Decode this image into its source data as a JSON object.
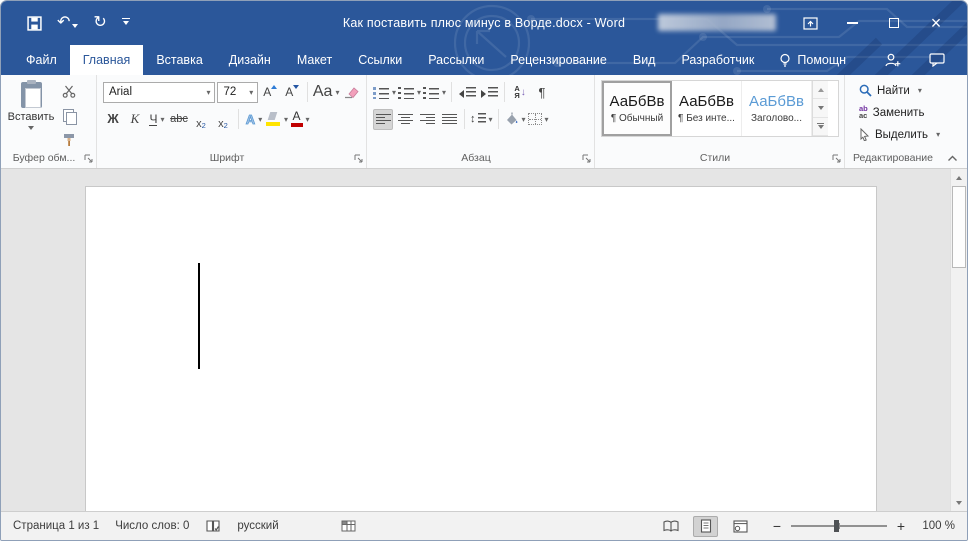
{
  "titlebar": {
    "title": "Как поставить плюс минус в Ворде.docx - Word"
  },
  "tabs": {
    "file": "Файл",
    "active": "Главная",
    "items": [
      "Главная",
      "Вставка",
      "Дизайн",
      "Макет",
      "Ссылки",
      "Рассылки",
      "Рецензирование",
      "Вид",
      "Разработчик"
    ],
    "assistant_label": "Помощн"
  },
  "ribbon": {
    "clipboard": {
      "paste_label": "Вставить",
      "group_label": "Буфер обм..."
    },
    "font": {
      "family_value": "Arial",
      "size_value": "72",
      "grow_letter": "А",
      "shrink_letter": "А",
      "case_label": "Aa",
      "bold": "Ж",
      "italic": "К",
      "underline": "Ч",
      "strikethrough": "abc",
      "subscript": {
        "base": "x",
        "script": "2"
      },
      "superscript": {
        "base": "x",
        "script": "2"
      },
      "effects_letter": "А",
      "fontcolor_letter": "А",
      "group_label": "Шрифт"
    },
    "paragraph": {
      "sort_top": "А",
      "sort_bottom": "Я",
      "pilcrow": "¶",
      "group_label": "Абзац"
    },
    "styles": {
      "group_label": "Стили",
      "items": [
        {
          "preview": "АаБбВв",
          "name": "¶ Обычный"
        },
        {
          "preview": "АаБбВв",
          "name": "¶ Без инте..."
        },
        {
          "preview": "АаБбВв",
          "name": "Заголово..."
        }
      ]
    },
    "editing": {
      "find_label": "Найти",
      "replace_label": "Заменить",
      "select_label": "Выделить",
      "replace_icon_top": "ab",
      "replace_icon_bottom": "ac",
      "group_label": "Редактирование"
    }
  },
  "statusbar": {
    "page_info": "Страница 1 из 1",
    "word_count": "Число слов: 0",
    "language": "русский",
    "zoom_out": "−",
    "zoom_in": "+",
    "zoom_level": "100 %"
  },
  "icons": {
    "undo": "↶",
    "redo": "↻",
    "close": "×"
  },
  "colors": {
    "titlebar_blue": "#2b579a",
    "accent_blue": "#2b579a",
    "highlight_yellow": "#ffe400",
    "font_color_red": "#c00000",
    "heading_preview_blue": "#5b9bd5"
  }
}
